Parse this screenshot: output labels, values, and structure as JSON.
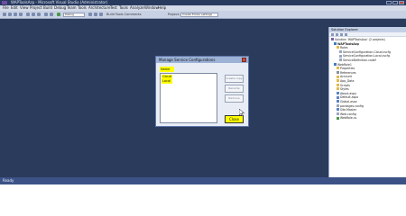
{
  "window": {
    "title": "WAPToolsAzp - Microsoft Visual Studio (Administrator)"
  },
  "menu": [
    "File",
    "Edit",
    "View",
    "Project",
    "Build",
    "Debug",
    "Team",
    "Tools",
    "Architecture",
    "Test",
    "Tools",
    "Analyze",
    "Window",
    "Help"
  ],
  "toolbar": {
    "config_value": "Debug",
    "comment_label": "Build Tools Comments",
    "project_label": "Project:",
    "project_value": "Create Folder settings"
  },
  "dialog": {
    "title": "Manage Service Configurations",
    "name_label": "Name",
    "configurations": [
      "Cloud",
      "Local"
    ],
    "buttons": {
      "create_copy": "Create copy",
      "rename": "Rename",
      "remove": "Remove",
      "close": "Close"
    }
  },
  "solution_explorer": {
    "title": "Solution Explorer",
    "items": [
      "Solution 'WAPToolsAzp' (2 projects)",
      "WAPToolsAzp",
      "Roles",
      "ServiceConfiguration.Cloud.cscfg",
      "ServiceConfiguration.Local.cscfg",
      "ServiceDefinition.csdef",
      "WebRole1",
      "Properties",
      "References",
      "Account",
      "App_Data",
      "Scripts",
      "Styles",
      "About.aspx",
      "Default.aspx",
      "Global.asax",
      "packages.config",
      "Site.Master",
      "Web.config",
      "WebRole.cs"
    ]
  },
  "status": {
    "text": "Ready"
  },
  "colors": {
    "highlight": "#ffff00",
    "background": "#2b3b5c",
    "statusbar": "#3c5287"
  }
}
